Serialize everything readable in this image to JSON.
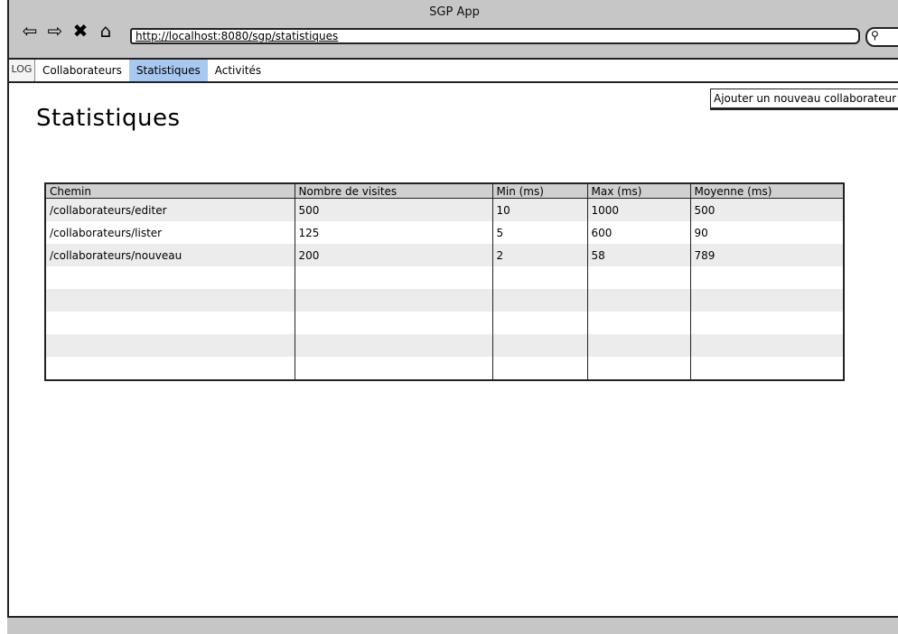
{
  "window": {
    "title": "SGP App"
  },
  "browser": {
    "url": "http://localhost:8080/sgp/statistiques"
  },
  "nav": {
    "logo": "LOG",
    "items": [
      {
        "label": "Collaborateurs"
      },
      {
        "label": "Statistiques",
        "active": true
      },
      {
        "label": "Activités"
      }
    ]
  },
  "main": {
    "add_button": "Ajouter un nouveau collaborateur",
    "title": "Statistiques",
    "table": {
      "headers": [
        "Chemin",
        "Nombre de visites",
        "Min (ms)",
        "Max (ms)",
        "Moyenne (ms)"
      ],
      "rows": [
        [
          "/collaborateurs/editer",
          "500",
          "10",
          "1000",
          "500"
        ],
        [
          "/collaborateurs/lister",
          "125",
          "5",
          "600",
          "90"
        ],
        [
          "/collaborateurs/nouveau",
          "200",
          "2",
          "58",
          "789"
        ],
        [
          "",
          "",
          "",
          "",
          ""
        ],
        [
          "",
          "",
          "",
          "",
          ""
        ],
        [
          "",
          "",
          "",
          "",
          ""
        ],
        [
          "",
          "",
          "",
          "",
          ""
        ],
        [
          "",
          "",
          "",
          "",
          ""
        ]
      ]
    }
  },
  "colors": {
    "chrome": "#c6c6c6",
    "active_tab": "#a7c8ef",
    "header_row": "#d0d0d0",
    "alt_row": "#ececec"
  }
}
